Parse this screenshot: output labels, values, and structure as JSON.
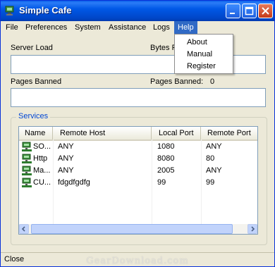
{
  "window": {
    "title": "Simple Cafe"
  },
  "menu": {
    "items": [
      "File",
      "Preferences",
      "System",
      "Assistance",
      "Logs",
      "Help"
    ],
    "help_dropdown": [
      "About",
      "Manual",
      "Register"
    ]
  },
  "fields": {
    "server_load_label": "Server Load",
    "bytes_label": "Bytes F",
    "pages_banned_label": "Pages Banned",
    "pages_banned_count_label": "Pages Banned:",
    "pages_banned_count": "0"
  },
  "services": {
    "group_title": "Services",
    "columns": [
      "Name",
      "Remote Host",
      "Local Port",
      "Remote Port"
    ],
    "rows": [
      {
        "name": "SO...",
        "remote_host": "ANY",
        "local_port": "1080",
        "remote_port": "ANY"
      },
      {
        "name": "Http",
        "remote_host": "ANY",
        "local_port": "8080",
        "remote_port": "80"
      },
      {
        "name": "Ma...",
        "remote_host": "ANY",
        "local_port": "2005",
        "remote_port": "ANY"
      },
      {
        "name": "CU...",
        "remote_host": "fdgdfgdfg",
        "local_port": "99",
        "remote_port": "99"
      }
    ]
  },
  "status": {
    "text": "Close"
  },
  "watermark": "GearDownload.com",
  "colors": {
    "titlebar": "#0058e6",
    "selection": "#316ac5",
    "group_title": "#0046d5"
  }
}
